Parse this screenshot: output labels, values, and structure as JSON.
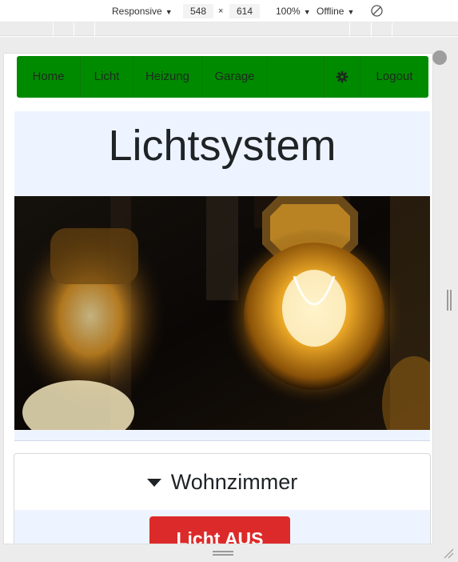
{
  "devtools": {
    "device": "Responsive",
    "width": "548",
    "times": "×",
    "height": "614",
    "zoom": "100%",
    "network": "Offline"
  },
  "nav": {
    "items": [
      "Home",
      "Licht",
      "Heizung",
      "Garage"
    ],
    "settings_icon": "gear-icon",
    "logout": "Logout",
    "color": "#008a00"
  },
  "hero": {
    "title": "Lichtsystem",
    "background": "#eef4ff"
  },
  "room": {
    "name": "Wohnzimmer",
    "expanded": true,
    "toggle_label": "Licht AUS",
    "toggle_color": "#dc2a2a"
  }
}
